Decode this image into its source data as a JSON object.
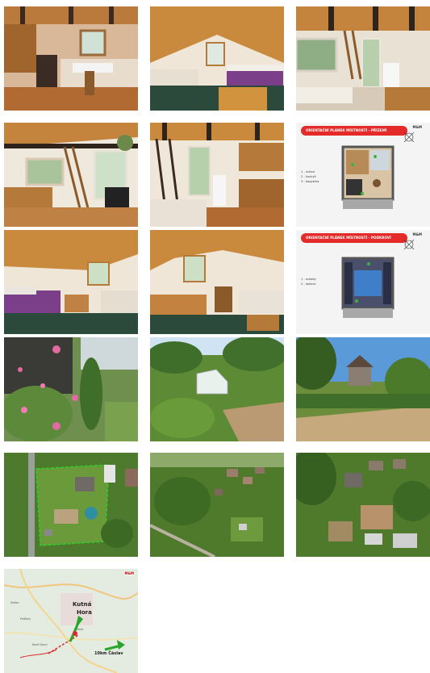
{
  "gallery": {
    "photos": [
      {
        "subject": "kitchen-room"
      },
      {
        "subject": "attic-bedroom"
      },
      {
        "subject": "living-room-ladder"
      },
      {
        "subject": "room-ladder-window"
      },
      {
        "subject": "kitchen-ladder"
      },
      {
        "subject": "floor-plan-ground"
      },
      {
        "subject": "attic-bedroom-purple"
      },
      {
        "subject": "attic-bedroom-table"
      },
      {
        "subject": "floor-plan-attic"
      },
      {
        "subject": "garden-roses"
      },
      {
        "subject": "garden-greenhouse"
      },
      {
        "subject": "garden-terrace"
      },
      {
        "subject": "aerial-plot"
      },
      {
        "subject": "aerial-valley"
      },
      {
        "subject": "aerial-houses"
      },
      {
        "subject": "location-map"
      }
    ]
  },
  "plans": {
    "ground": {
      "title": "ORIENTAČNÍ PLÁNEK MÍSTNOSTÍ - PŘÍZEMÍ",
      "legend": [
        "1 - vchod",
        "2 - kuchyň",
        "3 - koupelna"
      ]
    },
    "attic": {
      "title": "ORIENTAČNÍ PLÁNEK MÍSTNOSTÍ - PODKROVÍ",
      "legend": [
        "1 - schody",
        "2 - ložnice"
      ]
    },
    "logo": "M&M"
  },
  "map": {
    "town": "Kutná",
    "town2": "Hora",
    "distance": "10km Čáslav",
    "small_labels": [
      "Sedlec",
      "Malín",
      "Poličany",
      "Nové Dvory"
    ]
  },
  "colors": {
    "accent": "#e52a2a",
    "wood": "#c98a3e",
    "grass": "#4e8a2e"
  }
}
